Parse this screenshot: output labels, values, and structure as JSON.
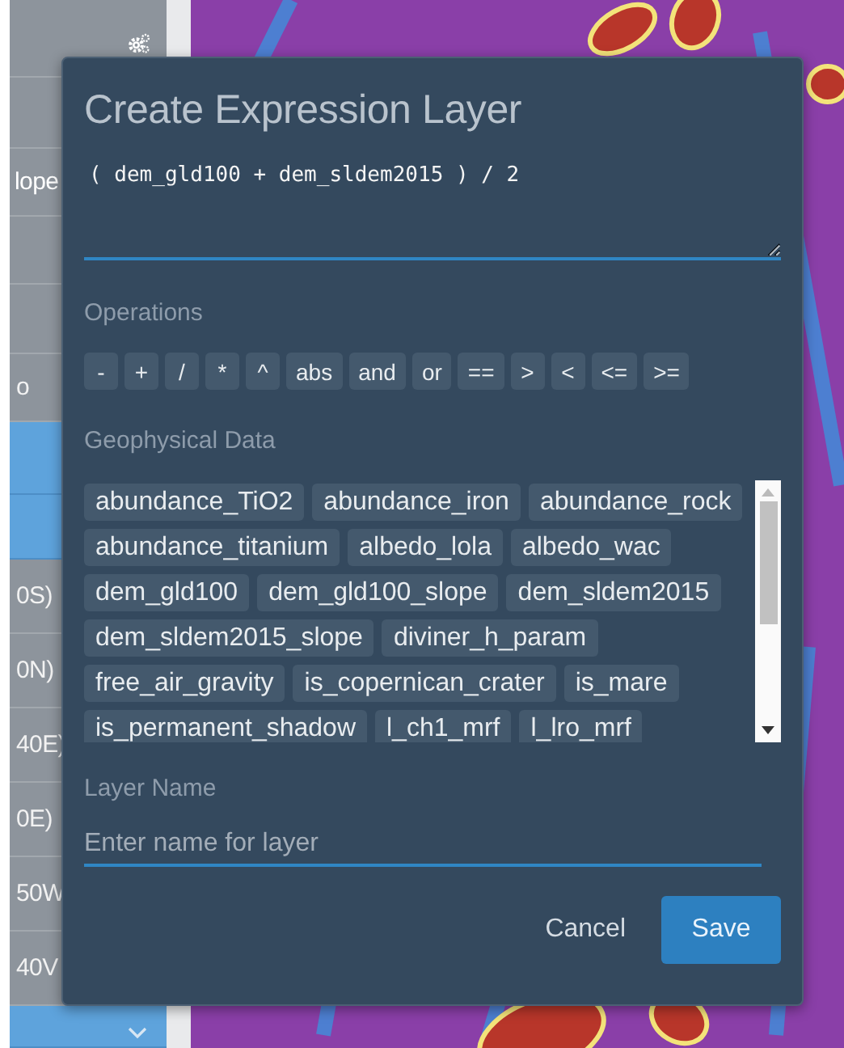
{
  "sidebar": {
    "items": [
      {
        "kind": "gear",
        "selected": false
      },
      {
        "kind": "text",
        "selected": false
      },
      {
        "kind": "text",
        "label": "lope",
        "selected": false
      },
      {
        "kind": "text",
        "selected": false
      },
      {
        "kind": "text",
        "selected": false
      },
      {
        "kind": "text",
        "label": "o",
        "selected": false
      },
      {
        "kind": "text",
        "selected": true
      },
      {
        "kind": "text",
        "selected": true
      },
      {
        "kind": "text",
        "label": "0S)",
        "selected": false
      },
      {
        "kind": "text",
        "label": "0N)",
        "selected": false
      },
      {
        "kind": "text",
        "label": "40E)",
        "selected": false
      },
      {
        "kind": "text",
        "label": "0E)",
        "selected": false
      },
      {
        "kind": "text",
        "label": "50W",
        "selected": false
      },
      {
        "kind": "text",
        "label": "40V",
        "selected": false
      },
      {
        "kind": "chevron",
        "selected": true
      }
    ]
  },
  "dialog": {
    "title": "Create Expression Layer",
    "expression": "( dem_gld100 + dem_sldem2015 ) / 2",
    "operations_label": "Operations",
    "operations": [
      "-",
      "+",
      "/",
      "*",
      "^",
      "abs",
      "and",
      "or",
      "==",
      ">",
      "<",
      "<=",
      ">="
    ],
    "data_label": "Geophysical Data",
    "data": [
      "abundance_TiO2",
      "abundance_iron",
      "abundance_rock",
      "abundance_titanium",
      "albedo_lola",
      "albedo_wac",
      "dem_gld100",
      "dem_gld100_slope",
      "dem_sldem2015",
      "dem_sldem2015_slope",
      "diviner_h_param",
      "free_air_gravity",
      "is_copernican_crater",
      "is_mare",
      "is_permanent_shadow",
      "l_ch1_mrf",
      "l_lro_mrf"
    ],
    "name_label": "Layer Name",
    "name_placeholder": "Enter name for layer",
    "buttons": [
      {
        "label": "Cancel",
        "kind": "link"
      },
      {
        "label": "Save",
        "kind": "primary"
      }
    ]
  }
}
